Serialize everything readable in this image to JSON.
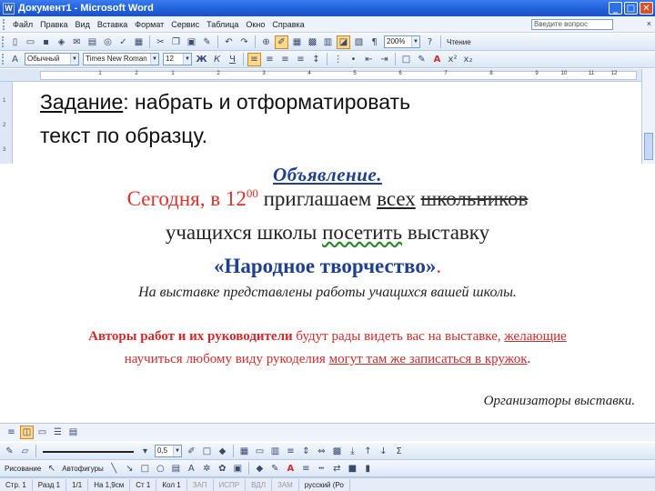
{
  "window": {
    "title": "Документ1 - Microsoft Word",
    "app_icon": "W",
    "controls": [
      "_",
      "□",
      "✕"
    ]
  },
  "menu": {
    "items": [
      "Файл",
      "Правка",
      "Вид",
      "Вставка",
      "Формат",
      "Сервис",
      "Таблица",
      "Окно",
      "Справка"
    ],
    "help_placeholder": "Введите вопрос",
    "doc_close": "×"
  },
  "standard_toolbar": {
    "zoom": "200%",
    "read_label": "Чтение"
  },
  "format_toolbar": {
    "style": "Обычный",
    "font": "Times New Roman",
    "size": "12",
    "bold": "Ж",
    "italic": "К",
    "underline": "Ч"
  },
  "ruler": {
    "ticks": [
      "1",
      "2",
      "1",
      "2",
      "3",
      "4",
      "5",
      "6",
      "7",
      "8",
      "9",
      "10",
      "11",
      "12"
    ]
  },
  "vruler": [
    "1",
    "2",
    "3"
  ],
  "heading": {
    "task_word": "Задание",
    "task_rest": ": набрать и отформатировать",
    "line2": "текст по образцу."
  },
  "document": {
    "announce": "Объявление.",
    "today_red": "Сегодня,  в 12",
    "today_sup": "00",
    "today_mid": " приглашаем ",
    "today_all": "всех",
    "today_space": " ",
    "today_strike": "школьников",
    "invite_a": "учащихся школы ",
    "invite_visit": "посетить",
    "invite_b": " выставку",
    "folk": "«Народное творчество»",
    "folk_dot": ".",
    "exhibit": "На выставке представлены работы учащихся вашей школы.",
    "authors_bold": "Авторы работ и их руководители",
    "authors_rest": " будут рады видеть вас на выставке, ",
    "authors_und": "желающие",
    "learn_a": "научиться любому виду рукоделия ",
    "learn_und": "могут там же записаться в кружок",
    "learn_dot": ".",
    "orgs": "Организаторы выставки."
  },
  "drawing_toolbar": {
    "line_width": "0,5",
    "autoshapes": "Автофигуры"
  },
  "drawing_label": "Рисование",
  "status": {
    "page": "Стр. 1",
    "section": "Разд 1",
    "pages": "1/1",
    "pos": "На 1,9см",
    "row": "Ст 1",
    "col": "Кол 1",
    "rec": "ЗАП",
    "trk": "ИСПР",
    "ext": "ВДЛ",
    "ovr": "ЗАМ",
    "lang": "русский (Ро"
  },
  "colors": {
    "title_blue": "#1f5fd8",
    "heading_blue": "#1f3f8f",
    "accent_red": "#e0302a"
  }
}
